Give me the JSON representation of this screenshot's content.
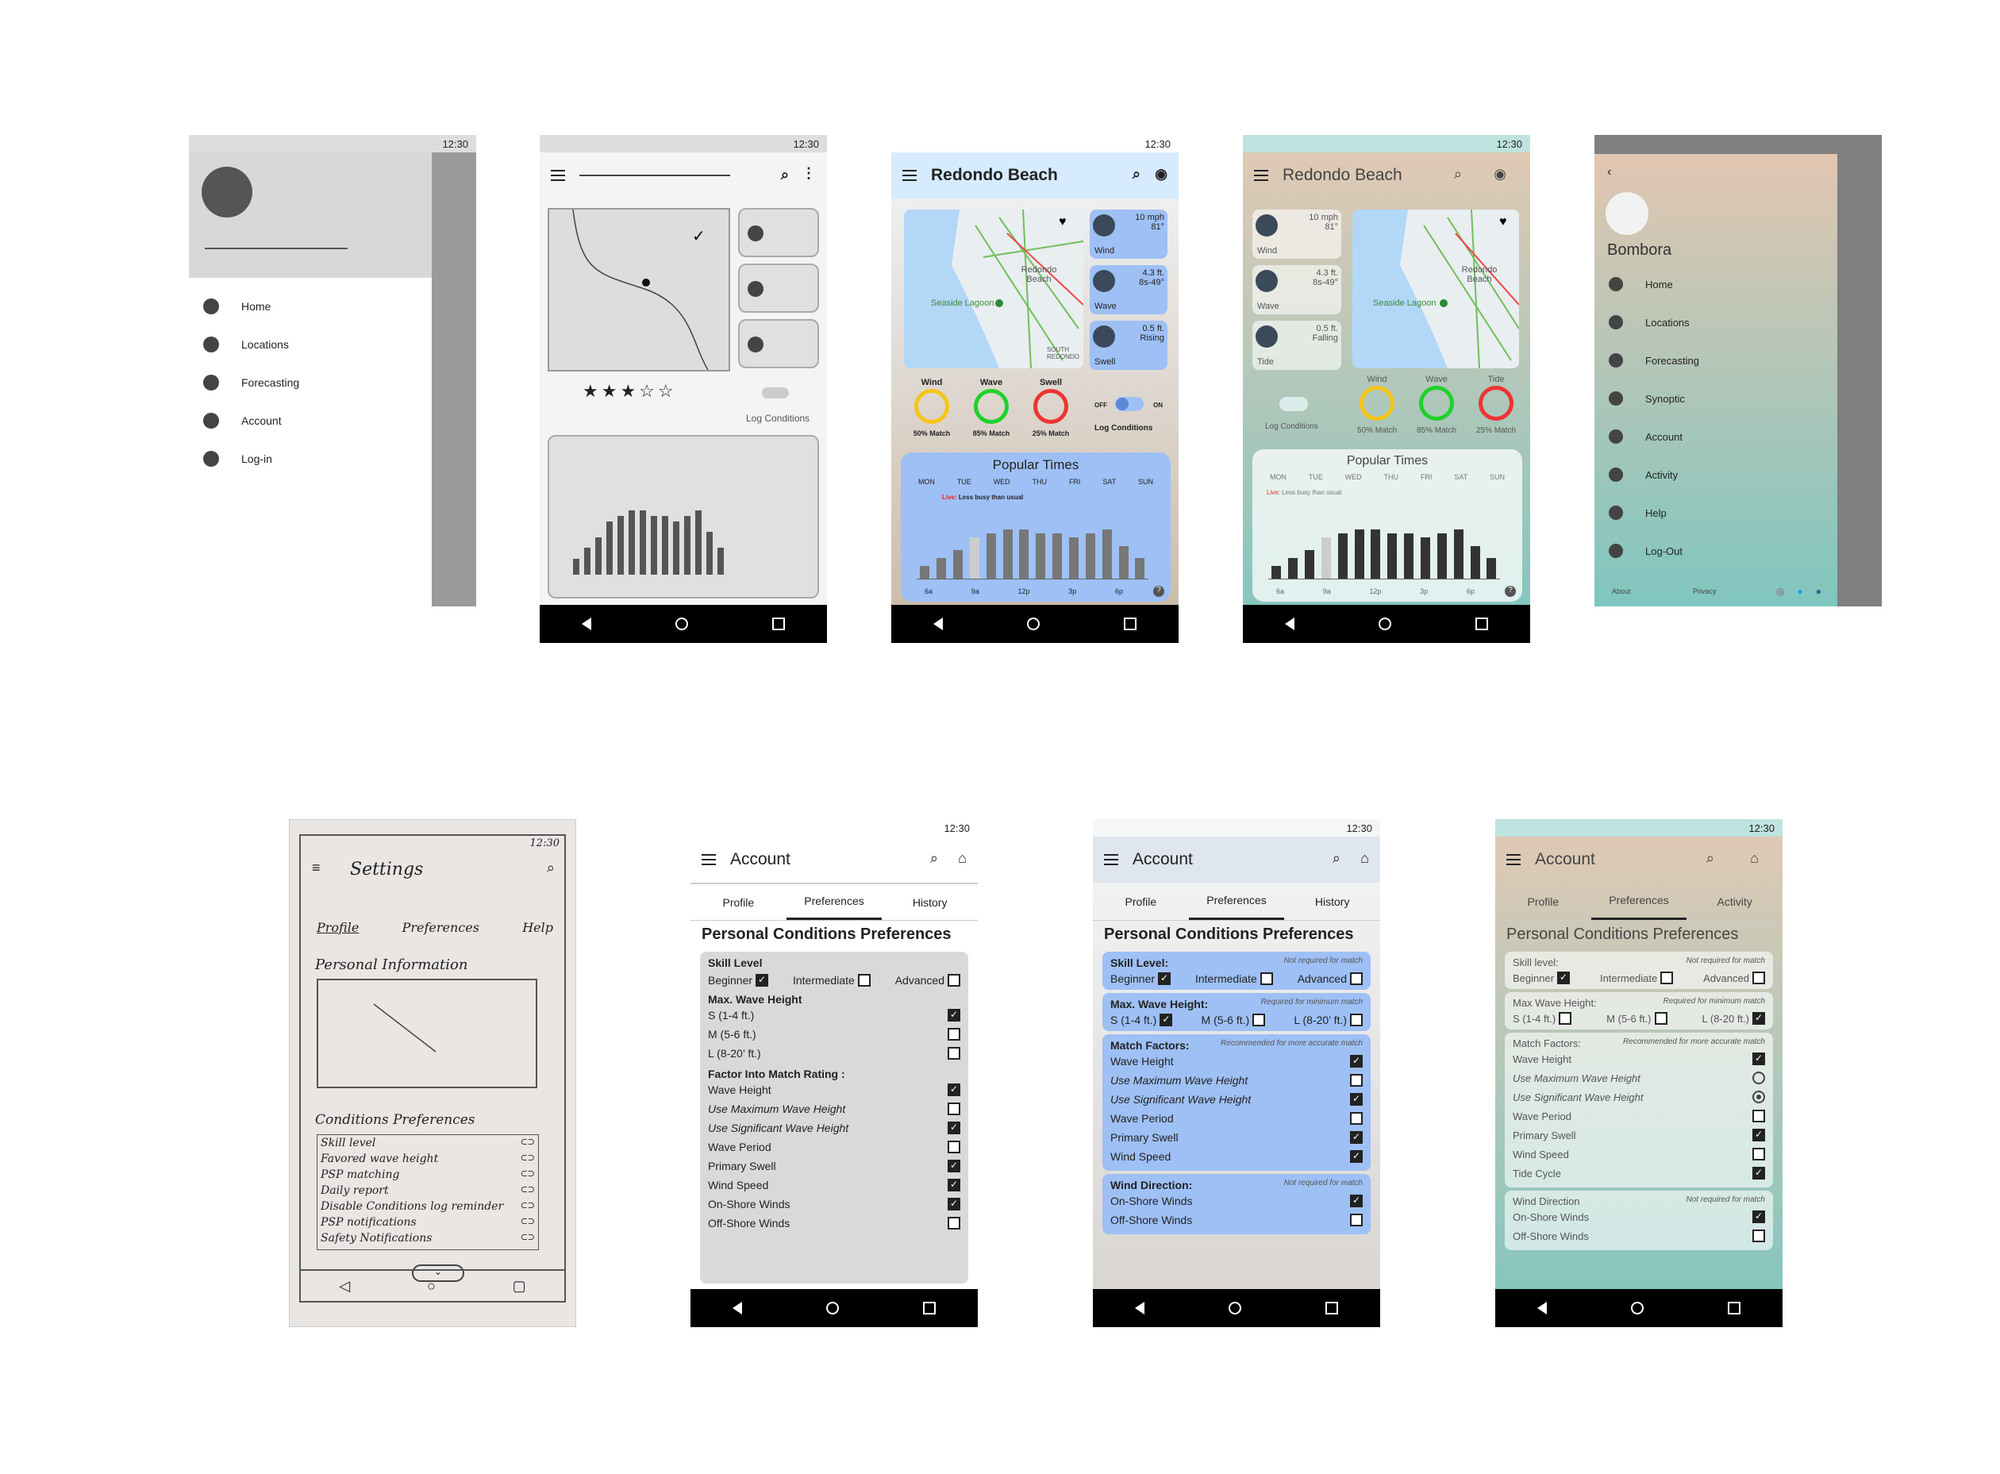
{
  "status_time": "12:30",
  "screen1": {
    "drawer_items": [
      "Home",
      "Locations",
      "Forecasting",
      "Account",
      "Log-in"
    ]
  },
  "screen2": {
    "log_conditions": "Log Conditions"
  },
  "screen3": {
    "title": "Redondo Beach",
    "map_labels": {
      "city": "Redondo Beach",
      "lagoon": "Seaside Lagoon",
      "south": "SOUTH REDONDO"
    },
    "chips": [
      {
        "value": "10 mph",
        "sub": "81°",
        "label": "Wind"
      },
      {
        "value": "4.3 ft.",
        "sub": "8s-49°",
        "label": "Wave"
      },
      {
        "value": "0.5 ft.",
        "sub": "Rising",
        "label": "Swell"
      }
    ],
    "gauges": [
      {
        "name": "Wind",
        "match": "50% Match",
        "color": "#f5c518"
      },
      {
        "name": "Wave",
        "match": "85% Match",
        "color": "#1fd12c"
      },
      {
        "name": "Swell",
        "match": "25% Match",
        "color": "#e33"
      }
    ],
    "toggle_off": "OFF",
    "toggle_on": "ON",
    "log_conditions": "Log Conditions",
    "popular_times": "Popular Times",
    "days": [
      "MON",
      "TUE",
      "WED",
      "THU",
      "FRI",
      "SAT",
      "SUN"
    ],
    "live_label": "Live:",
    "live_text": "Less busy than usual",
    "hours": [
      "6a",
      "9a",
      "12p",
      "3p",
      "6p"
    ],
    "bars": [
      0.15,
      0.25,
      0.35,
      0.5,
      0.55,
      0.6,
      0.6,
      0.55,
      0.55,
      0.5,
      0.55,
      0.6,
      0.4,
      0.25
    ],
    "help": "?"
  },
  "screen4": {
    "title": "Redondo Beach",
    "chips": [
      {
        "value": "10 mph",
        "sub": "81°",
        "label": "Wind"
      },
      {
        "value": "4.3 ft.",
        "sub": "8s-49°",
        "label": "Wave"
      },
      {
        "value": "0.5 ft.",
        "sub": "Falling",
        "label": "Tide"
      }
    ],
    "gauge_names": [
      "Wind",
      "Wave",
      "Tide"
    ],
    "gauge_matches": [
      "50% Match",
      "85% Match",
      "25% Match"
    ],
    "log_conditions": "Log Conditions",
    "popular_times": "Popular Times",
    "days": [
      "MON",
      "TUE",
      "WED",
      "THU",
      "FRI",
      "SAT",
      "SUN"
    ],
    "live_label": "Live:",
    "live_text": "Less busy than usual",
    "hours": [
      "6a",
      "9a",
      "12p",
      "3p",
      "6p"
    ]
  },
  "screen5": {
    "app_name": "Bombora",
    "items": [
      "Home",
      "Locations",
      "Forecasting",
      "Synoptic",
      "Account",
      "Activity",
      "Help",
      "Log-Out"
    ],
    "footer_about": "About",
    "footer_privacy": "Privacy"
  },
  "screen6": {
    "title": "Settings",
    "tabs": [
      "Profile",
      "Preferences",
      "Help"
    ],
    "personal": "Personal Information",
    "cond": "Conditions Preferences",
    "rows": [
      "Skill level",
      "Favored wave height",
      "PSP matching",
      "Daily report",
      "Disable Conditions log reminder",
      "PSP notifications",
      "Safety Notifications"
    ]
  },
  "screen7": {
    "title": "Account",
    "tabs": [
      "Profile",
      "Preferences",
      "History"
    ],
    "heading": "Personal Conditions Preferences",
    "skill_label": "Skill Level",
    "skills": [
      "Beginner",
      "Intermediate",
      "Advanced"
    ],
    "height_label": "Max. Wave Height",
    "heights": [
      "S (1-4 ft.)",
      "M (5-6 ft.)",
      "L (8-20’ ft.)"
    ],
    "factor_label": "Factor Into Match Rating :",
    "factors": [
      "Wave Height",
      "Use Maximum Wave Height",
      "Use Significant Wave Height",
      "Wave Period",
      "Primary Swell",
      "Wind Speed",
      "On-Shore Winds",
      "Off-Shore Winds"
    ]
  },
  "screen8": {
    "title": "Account",
    "tabs": [
      "Profile",
      "Preferences",
      "History"
    ],
    "heading": "Personal Conditions Preferences",
    "skill_label": "Skill Level:",
    "skill_note": "Not required for match",
    "skills": [
      "Beginner",
      "Intermediate",
      "Advanced"
    ],
    "height_label": "Max. Wave Height:",
    "height_note": "Required for minimum match",
    "heights": [
      "S (1-4 ft.)",
      "M (5-6 ft.)",
      "L (8-20’ ft.)"
    ],
    "match_label": "Match Factors:",
    "match_note": "Recommended for more accurate match",
    "factors": [
      "Wave Height",
      "Use Maximum Wave Height",
      "Use Significant Wave Height",
      "Wave Period",
      "Primary Swell",
      "Wind Speed"
    ],
    "wind_label": "Wind Direction:",
    "wind_note": "Not required for match",
    "winds": [
      "On-Shore Winds",
      "Off-Shore Winds"
    ]
  },
  "screen9": {
    "title": "Account",
    "tabs": [
      "Profile",
      "Preferences",
      "Activity"
    ],
    "heading": "Personal Conditions Preferences",
    "skill_label": "Skill level:",
    "skill_note": "Not required for match",
    "skills": [
      "Beginner",
      "Intermediate",
      "Advanced"
    ],
    "height_label": "Max Wave Height:",
    "height_note": "Required for minimum match",
    "heights": [
      "S (1-4 ft.)",
      "M (5-6 ft.)",
      "L (8-20 ft.)"
    ],
    "match_label": "Match Factors:",
    "match_note": "Recommended for more accurate match",
    "factors": [
      "Wave Height",
      "Use Maximum Wave Height",
      "Use Significant Wave Height",
      "Wave Period",
      "Primary Swell",
      "Wind Speed",
      "Tide Cycle"
    ],
    "wind_label": "Wind Direction",
    "wind_note": "Not required for match",
    "winds": [
      "On-Shore Winds",
      "Off-Shore Winds"
    ]
  }
}
